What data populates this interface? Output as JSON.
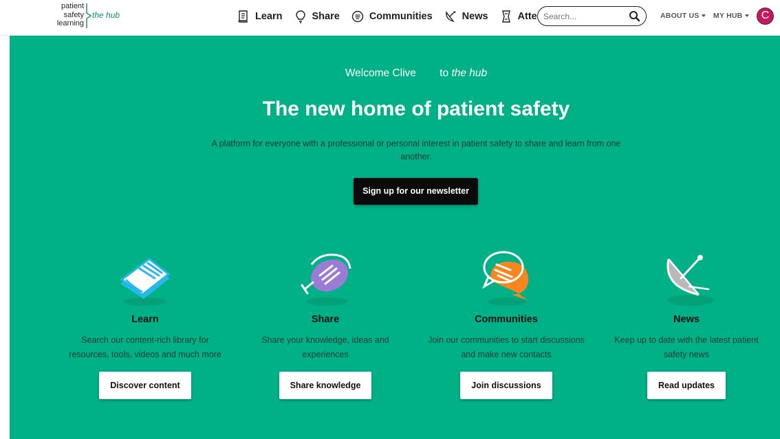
{
  "logo": {
    "line1": "patient",
    "line2": "safety",
    "line3": "learning",
    "tagline": "the hub"
  },
  "nav": [
    {
      "label": "Learn",
      "icon": "book-icon"
    },
    {
      "label": "Share",
      "icon": "lightbulb-icon"
    },
    {
      "label": "Communities",
      "icon": "chat-bubble-icon"
    },
    {
      "label": "News",
      "icon": "satellite-dish-icon"
    },
    {
      "label": "Attend",
      "icon": "scroll-icon"
    }
  ],
  "search": {
    "placeholder": "Search...",
    "icon": "search-icon"
  },
  "menus": {
    "about": "ABOUT US",
    "myhub": "MY HUB"
  },
  "user": {
    "initial": "C",
    "avatar_color": "#c5185e"
  },
  "hero": {
    "welcome": "Welcome Clive",
    "welcome_to": "to",
    "welcome_hub": "the hub",
    "title": "The new home of patient safety",
    "description": "A platform for everyone with a professional or personal interest in patient safety to share and learn from one another.",
    "newsletter_button": "Sign up for our newsletter",
    "background_color": "#00b187"
  },
  "cards": [
    {
      "title": "Learn",
      "text": "Search our content-rich library for resources, tools, videos and much more",
      "button": "Discover content",
      "icon": "book-icon",
      "color": "#29b6e8"
    },
    {
      "title": "Share",
      "text": "Share your knowledge, ideas and experiences",
      "button": "Share knowledge",
      "icon": "lightbulb-icon",
      "color": "#9b7bd4"
    },
    {
      "title": "Communities",
      "text": "Join our communities to start discussions and make new contacts",
      "button": "Join discussions",
      "icon": "chat-bubble-icon",
      "color": "#f7861e"
    },
    {
      "title": "News",
      "text": "Keep up to date with the latest patient safety news",
      "button": "Read updates",
      "icon": "satellite-dish-icon",
      "color": "#b8b8b8"
    }
  ]
}
